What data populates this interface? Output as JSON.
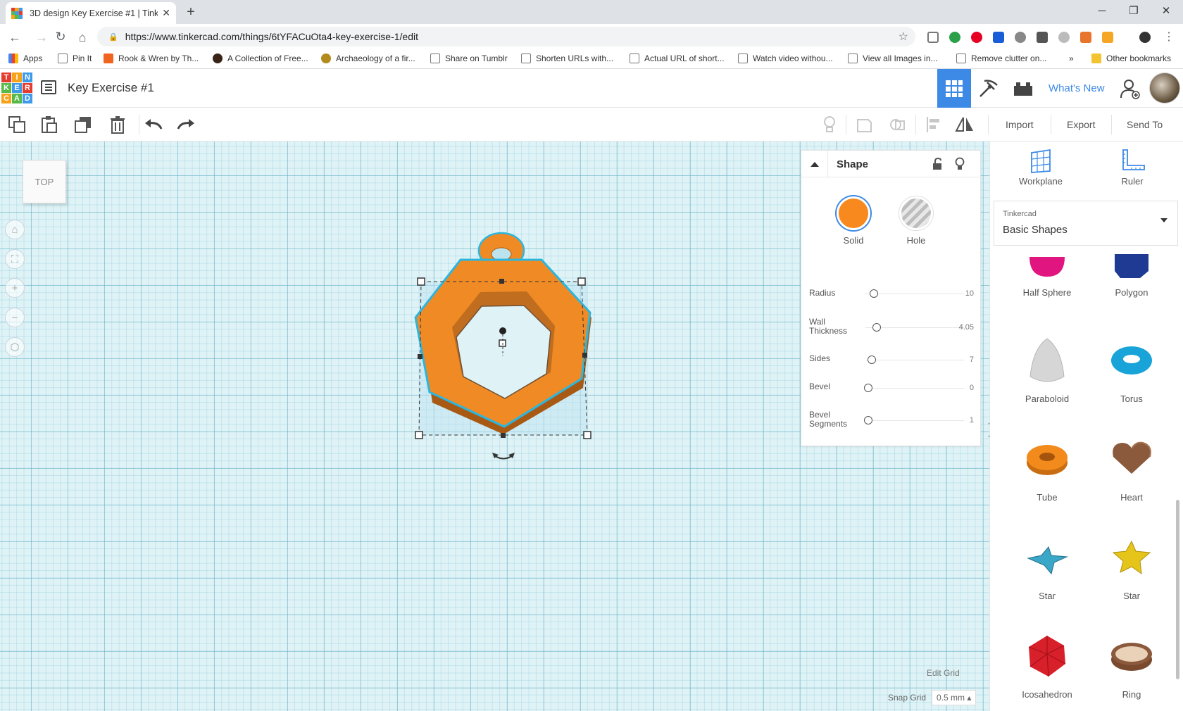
{
  "browser": {
    "tab_title": "3D design Key Exercise #1 | Tinke",
    "url": "https://www.tinkercad.com/things/6tYFACuOta4-key-exercise-1/edit",
    "window_controls": [
      "minimize-icon",
      "restore-icon",
      "close-icon"
    ],
    "bookmarks": [
      {
        "label": "Apps",
        "icon": "apps-grid-icon"
      },
      {
        "label": "Pin It",
        "icon": "page-icon"
      },
      {
        "label": "Rook & Wren by Th...",
        "icon": "etsy-icon"
      },
      {
        "label": "A Collection of Free...",
        "icon": "site-icon"
      },
      {
        "label": "Archaeology of a fir...",
        "icon": "site-icon"
      },
      {
        "label": "Share on Tumblr",
        "icon": "page-icon"
      },
      {
        "label": "Shorten URLs with...",
        "icon": "page-icon"
      },
      {
        "label": "Actual URL of short...",
        "icon": "page-icon"
      },
      {
        "label": "Watch video withou...",
        "icon": "page-icon"
      },
      {
        "label": "View all Images in...",
        "icon": "page-icon"
      },
      {
        "label": "Remove clutter on...",
        "icon": "page-icon"
      }
    ],
    "bookmarks_overflow": "»",
    "other_bookmarks": "Other bookmarks"
  },
  "header": {
    "logo_letters": [
      "T",
      "I",
      "N",
      "K",
      "E",
      "R",
      "C",
      "A",
      "D"
    ],
    "project_name": "Key Exercise #1",
    "whats_new": "What's New"
  },
  "toolbar": {
    "import": "Import",
    "export": "Export",
    "send_to": "Send To"
  },
  "canvas": {
    "view_cube_label": "TOP",
    "edit_grid": "Edit Grid",
    "snap_grid_label": "Snap Grid",
    "snap_grid_value": "0.5 mm ▴"
  },
  "inspector": {
    "title": "Shape",
    "solid_label": "Solid",
    "hole_label": "Hole",
    "solid_color": "#f7891f",
    "properties": [
      {
        "label": "Radius",
        "value": "10"
      },
      {
        "label": "Wall Thickness",
        "value": "4.05"
      },
      {
        "label": "Sides",
        "value": "7"
      },
      {
        "label": "Bevel",
        "value": "0"
      },
      {
        "label": "Bevel Segments",
        "value": "1"
      }
    ]
  },
  "right_panel": {
    "workplane": "Workplane",
    "ruler": "Ruler",
    "library_source": "Tinkercad",
    "library_name": "Basic Shapes",
    "shapes": [
      {
        "label": "Half Sphere",
        "color": "#e0157f"
      },
      {
        "label": "Polygon",
        "color": "#1f3a93"
      },
      {
        "label": "Paraboloid",
        "color": "#cfcfcf"
      },
      {
        "label": "Torus",
        "color": "#18a4d8"
      },
      {
        "label": "Tube",
        "color": "#f28a1c"
      },
      {
        "label": "Heart",
        "color": "#8b5a3c"
      },
      {
        "label": "Star",
        "color": "#3aa6c8"
      },
      {
        "label": "Star",
        "color": "#e6c51a"
      },
      {
        "label": "Icosahedron",
        "color": "#d8202a"
      },
      {
        "label": "Ring",
        "color": "#8b5a3c"
      }
    ]
  }
}
